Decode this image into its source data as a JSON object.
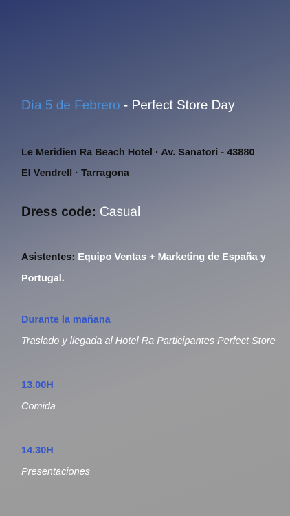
{
  "event": {
    "date": "Día 5 de Febrero",
    "title": " - Perfect Store Day"
  },
  "venue": {
    "line1": "Le Meridien Ra Beach Hotel · Av. Sanatori - 43880",
    "line2": "El Vendrell · Tarragona"
  },
  "dress_code": {
    "label": "Dress code:",
    "value": " Casual"
  },
  "attendees": {
    "label": "Asistentes:",
    "value": " Equipo Ventas + Marketing de España y Portugal."
  },
  "schedule": [
    {
      "time": "Durante la mañana",
      "desc": "Traslado y llegada al Hotel Ra Participantes Perfect Store"
    },
    {
      "time": "13.00H",
      "desc": "Comida"
    },
    {
      "time": "14.30H",
      "desc": "Presentaciones"
    }
  ],
  "colors": {
    "date_accent": "#4a90d9",
    "time_accent": "#3557c7",
    "label_text": "#111111",
    "value_text": "#ffffff"
  }
}
